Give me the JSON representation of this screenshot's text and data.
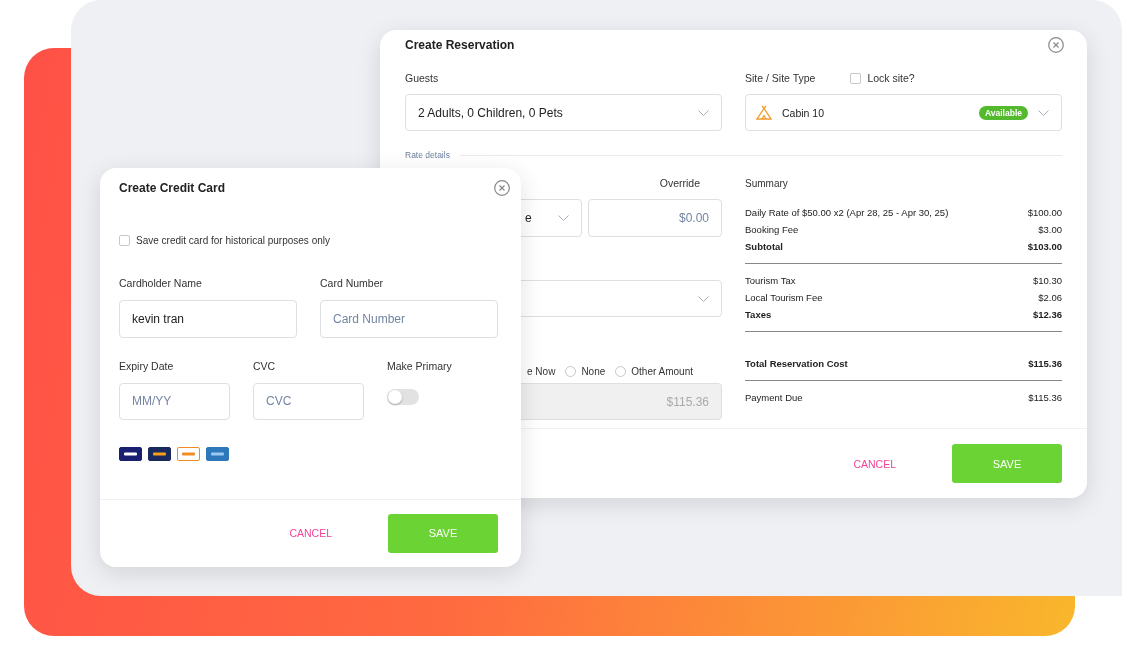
{
  "reservation_dialog": {
    "title": "Create Reservation",
    "guests": {
      "label": "Guests",
      "value": "2 Adults, 0 Children, 0 Pets"
    },
    "site": {
      "label": "Site / Site Type",
      "lock_label": "Lock site?",
      "locked": false,
      "value": "Cabin 10",
      "status": "Available"
    },
    "rate_details_label": "Rate details",
    "rate": {
      "value": "e",
      "override_label": "Override",
      "override_placeholder": "$0.00"
    },
    "payment_options": [
      {
        "label": "e Now",
        "kind": "cut"
      },
      {
        "label": "None",
        "kind": "radio",
        "selected": false
      },
      {
        "label": "Other Amount",
        "kind": "radio",
        "selected": false
      }
    ],
    "amount": {
      "value": "$115.36",
      "disabled": true
    },
    "summary": {
      "title": "Summary",
      "groups": [
        [
          {
            "label": "Daily Rate of $50.00 x2 (Apr 28, 25 - Apr 30, 25)",
            "amount": "$100.00",
            "bold": false
          },
          {
            "label": "Booking Fee",
            "amount": "$3.00",
            "bold": false
          },
          {
            "label": "Subtotal",
            "amount": "$103.00",
            "bold": true
          }
        ],
        [
          {
            "label": "Tourism Tax",
            "amount": "$10.30",
            "bold": false
          },
          {
            "label": "Local Tourism Fee",
            "amount": "$2.06",
            "bold": false
          },
          {
            "label": "Taxes",
            "amount": "$12.36",
            "bold": true
          }
        ],
        [
          {
            "label": "Total Reservation Cost",
            "amount": "$115.36",
            "bold": true
          }
        ],
        [
          {
            "label": "Payment Due",
            "amount": "$115.36",
            "bold": false
          }
        ]
      ]
    },
    "cancel": "CANCEL",
    "save": "SAVE"
  },
  "credit_card_dialog": {
    "title": "Create Credit Card",
    "historical": {
      "label": "Save credit card for historical purposes only",
      "checked": false
    },
    "cardholder": {
      "label": "Cardholder Name",
      "value": "kevin tran"
    },
    "card_number": {
      "label": "Card Number",
      "placeholder": "Card Number"
    },
    "expiry": {
      "label": "Expiry Date",
      "placeholder": "MM/YY"
    },
    "cvc": {
      "label": "CVC",
      "placeholder": "CVC"
    },
    "make_primary": {
      "label": "Make Primary",
      "on": false
    },
    "cancel": "CANCEL",
    "save": "SAVE"
  }
}
